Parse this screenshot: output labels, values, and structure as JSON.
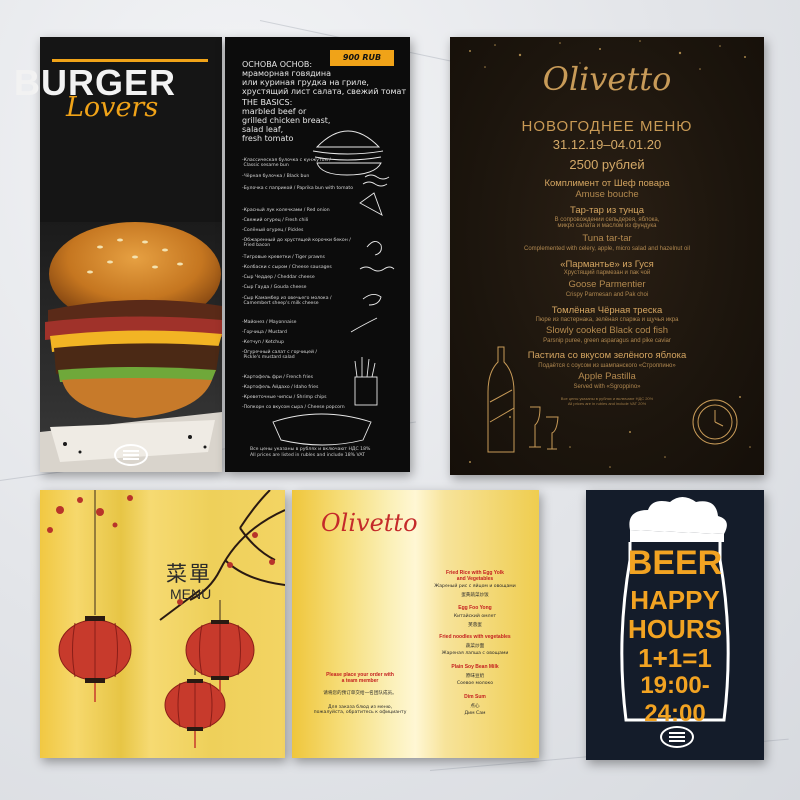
{
  "colors": {
    "burger_accent": "#f0a318",
    "ny_gold": "#c99a55",
    "chinese_red": "#c42a2a",
    "beer_orange": "#f2a322",
    "beer_bg": "#141c2a"
  },
  "burger_cover": {
    "title": "BURGER",
    "subtitle": "Lovers"
  },
  "burger_menu": {
    "price_tag": "900 RUB",
    "header_ru": "ОСНОВА ОСНОВ:\nмраморная говядина\nили куриная грудка на гриле,\nхрустящий лист салата, свежий томат",
    "header_en": "THE BASICS:\nmarbled beef or\ngrilled chicken breast,\nsalad leaf,\nfresh tomato",
    "items": [
      "-Классическая булочка с кунжутом /\n Classic sesame bun",
      "-Чёрная булочка / Black bun",
      "-Булочка с паприкой / Paprika bun with tomato",
      "-Красный лук колечками / Red onion",
      "-Свежий огурец / Fresh chili",
      "-Солёный огурец / Pickles",
      "-Обжаренный до хрустящей корочки бекон /\n Fried bacon",
      "-Тигровые креветки / Tiger prawns",
      "-Колбаски с сыром / Cheese sausages",
      "-Сыр Чеддер / Cheddar cheese",
      "-Сыр Гауда / Gouda cheese",
      "-Сыр Камамбер из овечьего молока /\n Camembert sheep's milk cheese",
      "-Майонез / Mayonnaise",
      "-Горчица / Mustard",
      "-Кетчуп / Ketchup",
      "-Огуречный салат с горчицей /\n Pickle's mustard salad",
      "-Картофель фри / French fries",
      "-Картофель Айдахо / Idaho fries",
      "-Креветочные чипсы / Shrimp chips",
      "-Попкорн со вкусом сыра / Cheese popcorn"
    ],
    "footer": "Все цены указаны в рублях и включают НДС 18%\nAll prices are listed in rubles and include 18% VAT"
  },
  "ny_menu": {
    "brand": "Olivetto",
    "title": "НОВОГОДНЕЕ МЕНЮ",
    "dates": "31.12.19–04.01.20",
    "price": "2500 рублей",
    "courses": [
      {
        "ru": "Комплимент от Шеф повара",
        "en": "Amuse bouche",
        "desc_ru": "",
        "desc_en": ""
      },
      {
        "ru": "Тар-тар из тунца",
        "en": "Tuna tar-tar",
        "desc_ru": "В сопровождении сельдерея, яблока,\nмикро салата и маслом из фундука",
        "desc_en": "Complemented with celery, apple, micro salad and hazelnut oil"
      },
      {
        "ru": "«Пармантье» из Гуся",
        "en": "Goose Parmentier",
        "desc_ru": "Хрустящий пармезан и пак чой",
        "desc_en": "Crispy Parmesan and Pak choi"
      },
      {
        "ru": "Томлёная Чёрная треска",
        "en": "Slowly cooked Black cod fish",
        "desc_ru": "Пюре из пастернака, зелёная спаржа и щучья икра",
        "desc_en": "Parsnip puree, green asparagus and pike caviar"
      },
      {
        "ru": "Пастила со вкусом зелёного яблока",
        "en": "Apple Pastilla",
        "desc_ru": "Подаётся с соусом из шампанского «Строппино»",
        "desc_en": "Served with «Sgroppino»"
      }
    ],
    "fine_print": "Все цены указаны в рублях и включают НДС 20%\nAll prices are in rubles and include VAT 20%"
  },
  "chinese_cover": {
    "title_cn": "菜單",
    "title_en": "MENU"
  },
  "olivetto_inside": {
    "brand": "Olivetto",
    "notice_en": "Please place your order with\na team member",
    "notice_cn": "请将您的预订单交给一名团队成员。",
    "notice_ru": "Для заказа блюд из меню,\nпожалуйста, обратитесь к официанту",
    "dishes": [
      {
        "en": "Fried Rice with Egg Yolk\nand Vegetables",
        "ru": "Жареный рис с яйцом и овощами",
        "cn": "蛋黄蔬菜炒饭"
      },
      {
        "en": "Egg Foo Yong",
        "ru": "Китайский омлет",
        "cn": "芙蓉蛋"
      },
      {
        "en": "Fried noodles with vegetables",
        "ru": "Жареная лапша с овощами",
        "cn": "蔬菜炒面"
      },
      {
        "en": "Plain Soy Bean Milk",
        "ru": "Соевое молоко",
        "cn": "原味豆奶"
      },
      {
        "en": "Dim Sum",
        "ru": "Дим Сам",
        "cn": "点心"
      }
    ]
  },
  "beer": {
    "title": "BEER",
    "line1": "HAPPY",
    "line2": "HOURS",
    "offer": "1+1=1",
    "time_start": "19:00-",
    "time_end": "24:00"
  }
}
